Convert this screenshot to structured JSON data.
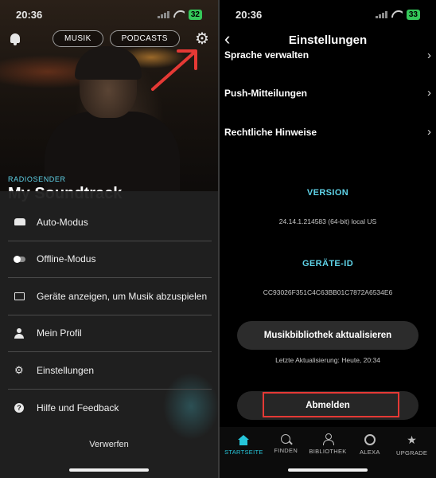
{
  "left": {
    "status": {
      "time": "20:36",
      "battery": "32"
    },
    "pills": [
      "MUSIK",
      "PODCASTS"
    ],
    "hero": {
      "label": "RADIOSENDER",
      "title": "My Soundtrack"
    },
    "menu": [
      {
        "label": "Auto-Modus",
        "icon": "car-icon"
      },
      {
        "label": "Offline-Modus",
        "icon": "toggle-icon"
      },
      {
        "label": "Geräte anzeigen, um Musik abzuspielen",
        "icon": "cast-icon"
      },
      {
        "label": "Mein Profil",
        "icon": "person-icon"
      },
      {
        "label": "Einstellungen",
        "icon": "gear-icon"
      },
      {
        "label": "Hilfe und Feedback",
        "icon": "help-icon"
      }
    ],
    "discard": "Verwerfen"
  },
  "right": {
    "status": {
      "time": "20:36",
      "battery": "33"
    },
    "title": "Einstellungen",
    "rows": [
      "Sprache verwalten",
      "Push-Mitteilungen",
      "Rechtliche Hinweise"
    ],
    "version": {
      "title": "VERSION",
      "value": "24.14.1.214583 (64-bit) local US"
    },
    "device": {
      "title": "GERÄTE-ID",
      "value": "CC93026F351C4C63BB01C7872A6534E6"
    },
    "refresh_button": "Musikbibliothek aktualisieren",
    "last_update": "Letzte Aktualisierung: Heute, 20:34",
    "logout_button": "Abmelden",
    "tabs": [
      {
        "label": "STARTSEITE",
        "icon": "home-icon",
        "active": true
      },
      {
        "label": "FINDEN",
        "icon": "search-icon",
        "active": false
      },
      {
        "label": "BIBLIOTHEK",
        "icon": "library-icon",
        "active": false
      },
      {
        "label": "ALEXA",
        "icon": "alexa-icon",
        "active": false
      },
      {
        "label": "UPGRADE",
        "icon": "star-icon",
        "active": false
      }
    ]
  },
  "colors": {
    "accent": "#26c6da",
    "highlight": "#e53935",
    "background": "#000000"
  }
}
